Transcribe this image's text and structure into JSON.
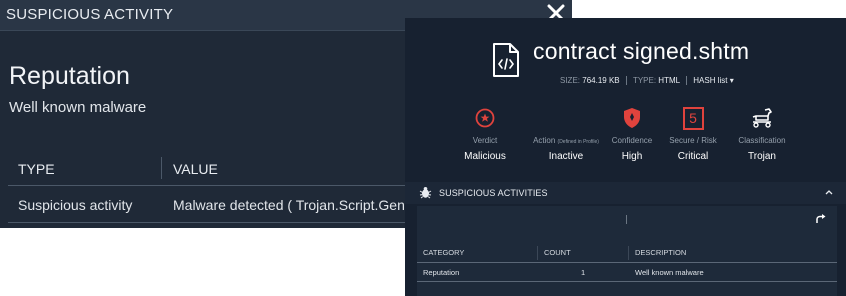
{
  "back_panel": {
    "title": "SUSPICIOUS ACTIVITY",
    "reputation_title": "Reputation",
    "reputation_subtitle": "Well known malware",
    "table": {
      "columns": [
        "TYPE",
        "VALUE"
      ],
      "rows": [
        [
          "Suspicious activity",
          "Malware detected ( Trojan.Script.Gen"
        ]
      ]
    }
  },
  "front_panel": {
    "file_name": "contract signed.shtm",
    "file_icon": "code-file-icon",
    "meta": {
      "size_label": "SIZE:",
      "size_value": "764.19 KB",
      "type_label": "TYPE:",
      "type_value": "HTML",
      "hash_label": "HASH list"
    },
    "metrics": [
      {
        "label": "Verdict",
        "value": "Malicious",
        "icon": "bug-circle-icon"
      },
      {
        "label": "Action",
        "label_note": "(Defined in Profile)",
        "value": "Inactive",
        "icon": "none"
      },
      {
        "label": "Confidence",
        "value": "High",
        "icon": "shield-icon"
      },
      {
        "label": "Secure / Risk",
        "value": "Critical",
        "icon": "risk-score-icon",
        "badge": "5"
      },
      {
        "label": "Classification",
        "value": "Trojan",
        "icon": "trojan-horse-icon"
      }
    ],
    "suspicious_activities": {
      "title": "SUSPICIOUS ACTIVITIES",
      "icon": "bug-icon",
      "table": {
        "columns": [
          "CATEGORY",
          "COUNT",
          "DESCRIPTION"
        ],
        "rows": [
          {
            "category": "Reputation",
            "count": "1",
            "description": "Well known malware"
          }
        ]
      }
    }
  },
  "colors": {
    "back_bg": "#1f2937",
    "front_bg": "#172130",
    "danger": "#e0433d",
    "text": "#e8ecf1"
  }
}
